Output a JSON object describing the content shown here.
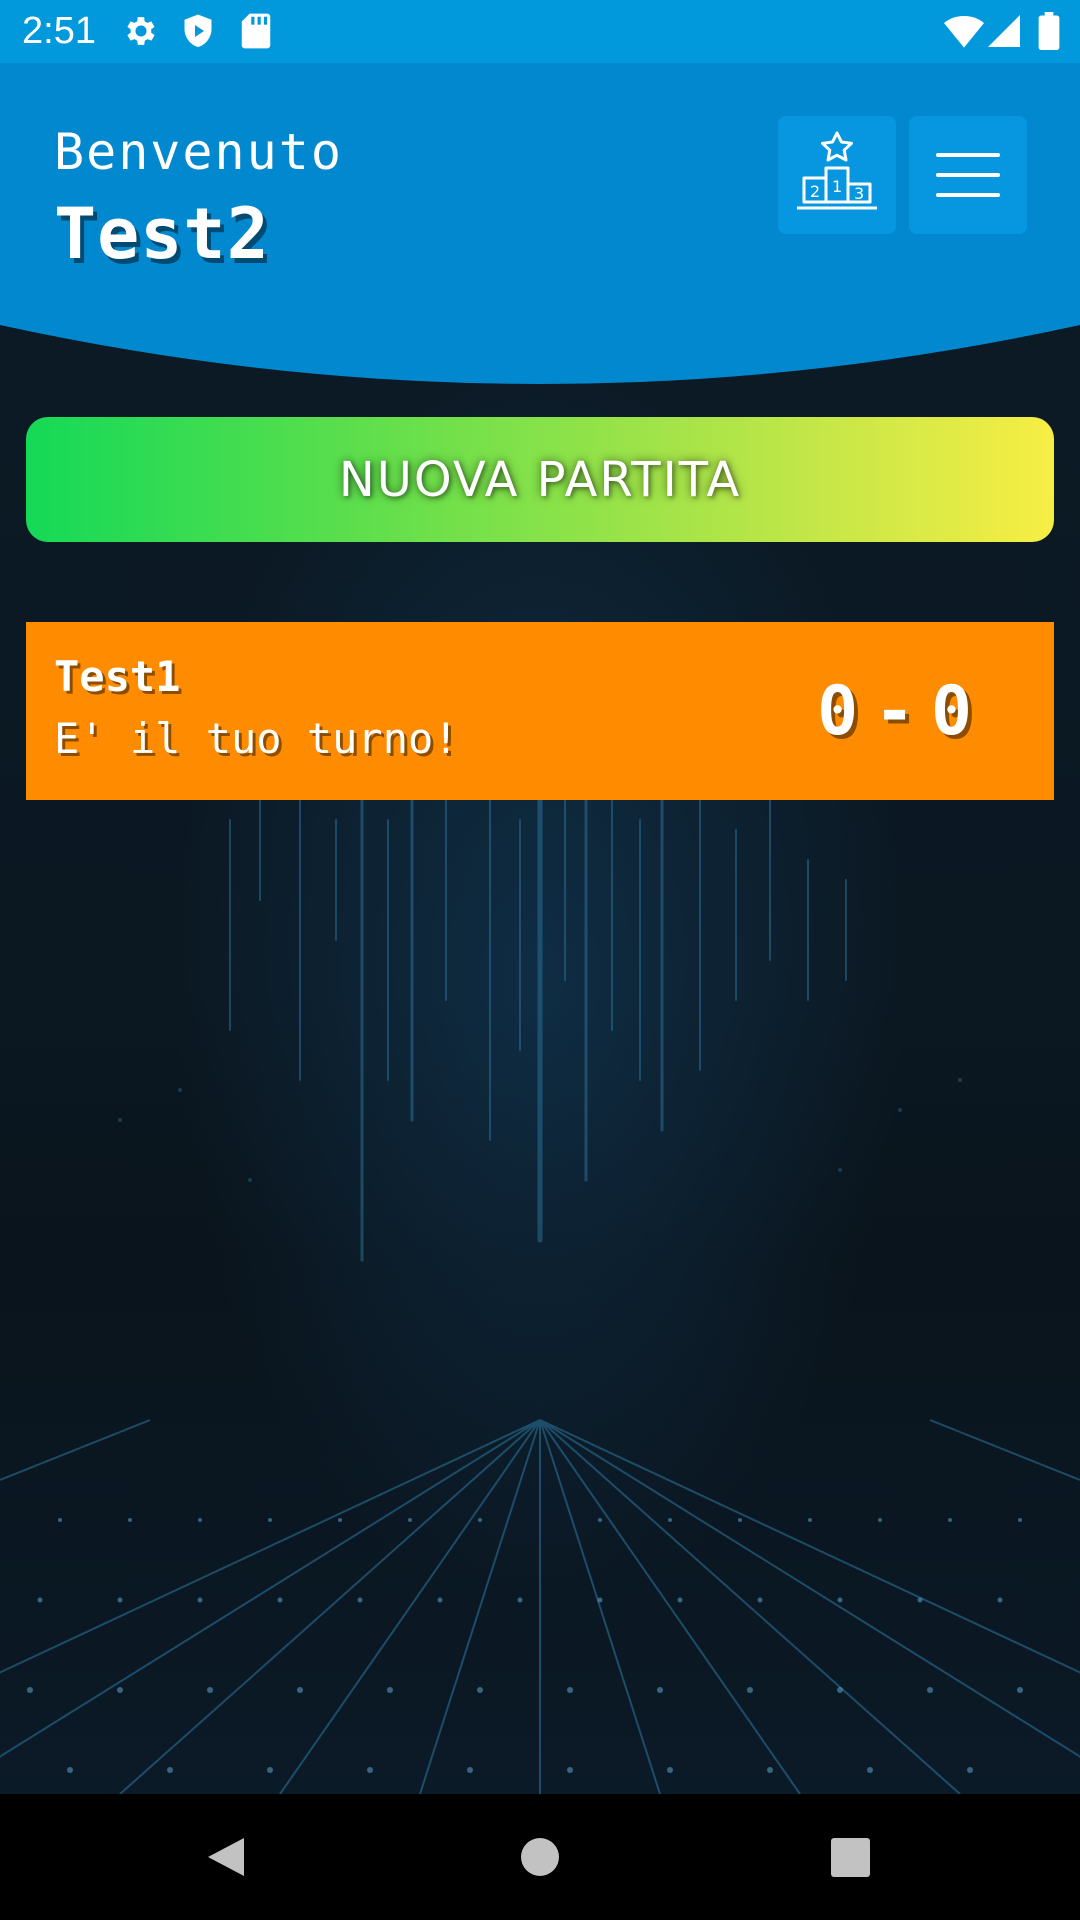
{
  "status_bar": {
    "time": "2:51",
    "icons": [
      "gear-icon",
      "shield-play-icon",
      "sd-card-icon",
      "wifi-icon",
      "cellular-signal-icon",
      "battery-icon"
    ]
  },
  "header": {
    "welcome_label": "Benvenuto",
    "username": "Test2",
    "buttons": [
      "leaderboard-podium-icon",
      "hamburger-menu-icon"
    ]
  },
  "new_match": {
    "label": "NUOVA PARTITA"
  },
  "matches": [
    {
      "opponent": "Test1",
      "status": "E' il tuo turno!",
      "score_left": "0",
      "score_separator": "-",
      "score_right": "0"
    }
  ],
  "nav_bar": {
    "icons": [
      "back-triangle-icon",
      "home-circle-icon",
      "recents-square-icon"
    ]
  },
  "colors": {
    "status_bar": "#0199dc",
    "header": "#0288cf",
    "button": "#0797e0",
    "gradient_start": "#14d957",
    "gradient_end": "#f7ee44",
    "match_card": "#ff8c00",
    "background": "#0b1620"
  }
}
